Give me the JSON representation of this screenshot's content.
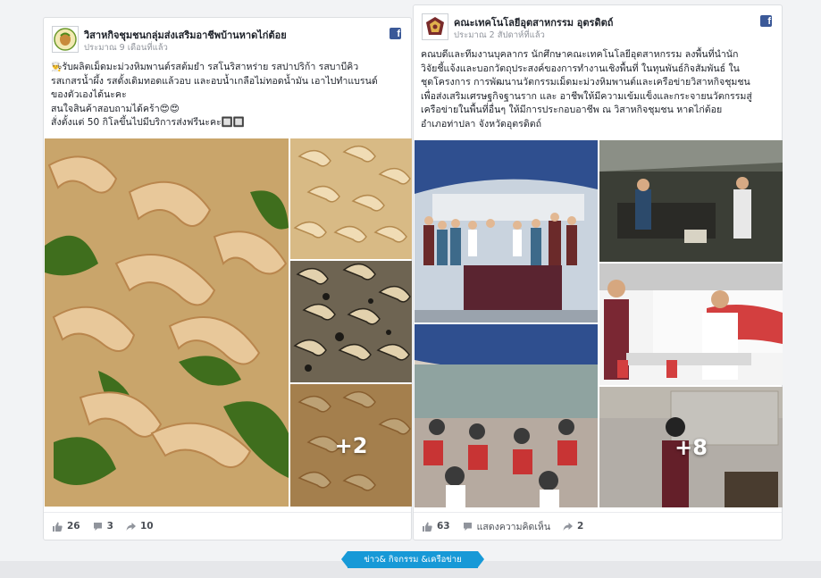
{
  "posts": [
    {
      "page_name": "วิสาหกิจชุมชนกลุ่มส่งเสริมอาชีพบ้านหาดไก่ต้อย",
      "time": "ประมาณ 9 เดือนที่แล้ว",
      "text_lines": [
        "รับผลิตเม็ดมะม่วงหิมพานต์รสต้มยำ รสโนริสาหร่าย รสปาปริก้า รสบาบีคิว",
        "รสเกสรน้ำผึ้ง รสดั้งเดิมทอดแล้วอบ และอบน้ำเกลือไม่ทอดน้ำมัน เอาไปทำแบรนด์",
        "ของตัวเองได้นะคะ",
        "สนใจสินค้าสอบถามได้คร้า😍😍",
        "สั่งตั้งแต่ 50 กิโลขึ้นไปมีบริการส่งฟรีนะคะ🔲🔲"
      ],
      "more_photos": "+2",
      "likes": "26",
      "comments": "3",
      "shares": "10"
    },
    {
      "page_name": "คณะเทคโนโลยีอุตสาหกรรม อุตรดิตถ์",
      "time": "ประมาณ 2 สัปดาห์ที่แล้ว",
      "text_lines": [
        "คณบดีและทีมงานบุคลากร นักศึกษาคณะเทคโนโลยีอุตสาหกรรม ลงพื้นที่นำนัก",
        "วิจัยชี้แจ้งและบอกวัตถุประสงค์ของการทำงานเชิงพื้นที่ ในทุนพันธ์กิจสัมพันธ์ ใน",
        "ชุดโครงการ การพัฒนานวัตกรรมเม็ดมะม่วงหิมพานต์และเครือข่ายวิสาหกิจชุมชน",
        "เพื่อส่งเสริมเศรษฐกิจฐานราก และ อาชีพให้มีความเข้มแข็งและกระจายนวัตกรรมสู่",
        "เครือข่ายในพื้นที่อื่นๆ ให้มีการประกอบอาชีพ ณ วิสาหกิจชุมชน หาดไก่ต้อย",
        "อำเภอท่าปลา จังหวัดอุตรดิตถ์"
      ],
      "more_photos": "+8",
      "likes": "63",
      "comment_action": "แสดงความคิดเห็น",
      "shares": "2"
    }
  ],
  "section_label": "ข่าว& กิจกรรม &เครือข่าย",
  "colors": {
    "facebook_blue": "#3b5998",
    "ribbon_blue": "#1799d7"
  },
  "icons": [
    "facebook-icon",
    "like-icon",
    "comment-icon",
    "share-icon"
  ]
}
